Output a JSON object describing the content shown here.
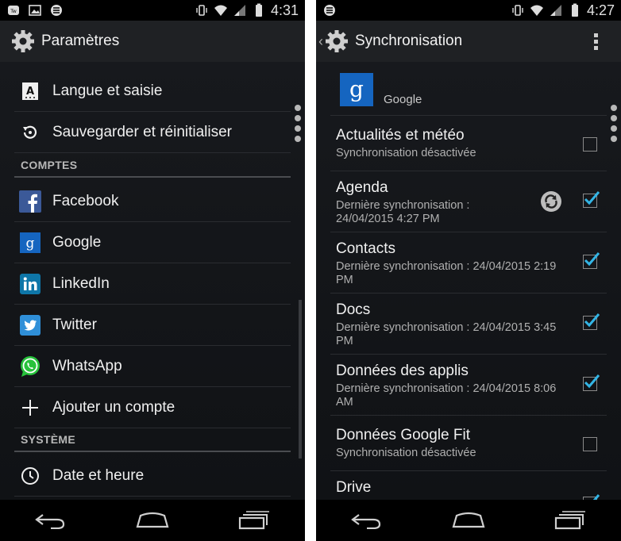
{
  "left": {
    "status_time": "4:31",
    "title": "Paramètres",
    "items_top": [
      {
        "label": "Langue et saisie",
        "icon": "language-icon"
      },
      {
        "label": "Sauvegarder et réinitialiser",
        "icon": "restore-icon"
      }
    ],
    "section_accounts": "COMPTES",
    "accounts": [
      {
        "label": "Facebook",
        "icon": "facebook-icon",
        "color": "#3b5998"
      },
      {
        "label": "Google",
        "icon": "google-icon",
        "color": "#1565c0"
      },
      {
        "label": "LinkedIn",
        "icon": "linkedin-icon",
        "color": "#0e76a8"
      },
      {
        "label": "Twitter",
        "icon": "twitter-icon",
        "color": "#2f8fd8"
      },
      {
        "label": "WhatsApp",
        "icon": "whatsapp-icon",
        "color": "#27c23b"
      },
      {
        "label": "Ajouter un compte",
        "icon": "plus-icon"
      }
    ],
    "section_system": "SYSTÈME",
    "system": [
      {
        "label": "Date et heure",
        "icon": "clock-icon"
      }
    ]
  },
  "right": {
    "status_time": "4:27",
    "title": "Synchronisation",
    "account_name": "Google",
    "items": [
      {
        "title": "Actualités et météo",
        "sub": "Synchronisation désactivée",
        "checked": false
      },
      {
        "title": "Agenda",
        "sub": "Dernière synchronisation : 24/04/2015 4:27 PM",
        "checked": true,
        "syncing": true
      },
      {
        "title": "Contacts",
        "sub": "Dernière synchronisation : 24/04/2015 2:19 PM",
        "checked": true
      },
      {
        "title": "Docs",
        "sub": "Dernière synchronisation : 24/04/2015 3:45 PM",
        "checked": true
      },
      {
        "title": "Données des applis",
        "sub": "Dernière synchronisation : 24/04/2015 8:06 AM",
        "checked": true
      },
      {
        "title": "Données Google Fit",
        "sub": "Synchronisation désactivée",
        "checked": false
      },
      {
        "title": "Drive",
        "sub": "",
        "checked": true
      }
    ]
  },
  "colors": {
    "check": "#33b5e5",
    "bg": "#121418"
  }
}
